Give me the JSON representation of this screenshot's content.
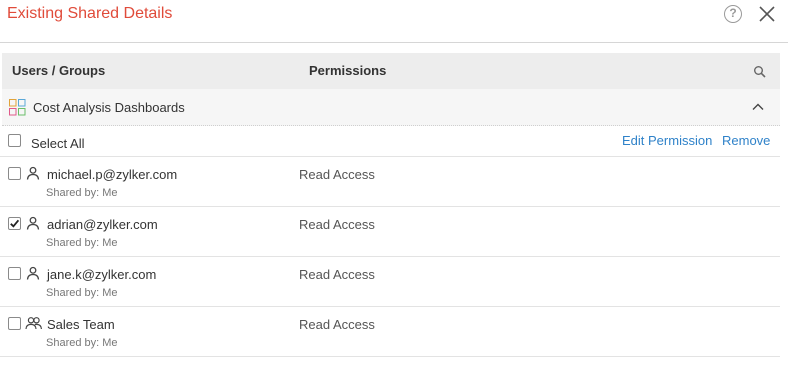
{
  "dialog": {
    "title": "Existing Shared Details",
    "help": "?"
  },
  "table": {
    "col_users": "Users / Groups",
    "col_permissions": "Permissions"
  },
  "group": {
    "label": "Cost Analysis Dashboards"
  },
  "select_all": {
    "label": "Select All",
    "checked": false
  },
  "actions": {
    "edit_permission": "Edit Permission",
    "remove": "Remove"
  },
  "entries": [
    {
      "name": "michael.p@zylker.com",
      "shared_by": "Shared by: Me",
      "permission": "Read Access",
      "type": "user",
      "checked": false
    },
    {
      "name": "adrian@zylker.com",
      "shared_by": "Shared by: Me",
      "permission": "Read Access",
      "type": "user",
      "checked": true
    },
    {
      "name": "jane.k@zylker.com",
      "shared_by": "Shared by: Me",
      "permission": "Read Access",
      "type": "user",
      "checked": false
    },
    {
      "name": "Sales Team",
      "shared_by": "Shared by: Me",
      "permission": "Read Access",
      "type": "group",
      "checked": false
    }
  ],
  "colors": {
    "title": "#e04b3a",
    "link": "#2f82c9",
    "header_bg": "#ededed",
    "group_bg": "#f6f6f6"
  },
  "icons": [
    "help-icon",
    "close-icon",
    "search-icon",
    "dashboard-icon",
    "chevron-up-icon",
    "user-icon",
    "group-icon"
  ]
}
